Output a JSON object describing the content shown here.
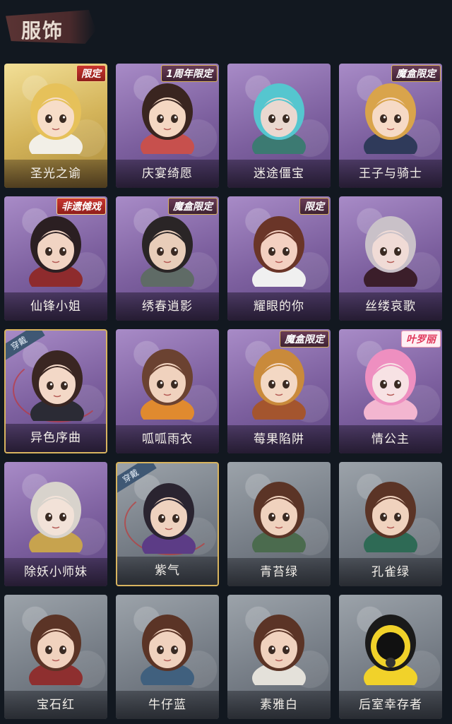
{
  "header": {
    "title": "服饰"
  },
  "worn_label": "穿戴",
  "costumes": [
    {
      "name": "圣光之谕",
      "badge": "限定",
      "badge_style": "red",
      "rarity": "gold",
      "worn": false,
      "hair": "#e6c15a",
      "skin": "#f7ddc8",
      "cloth": "#f2efe7"
    },
    {
      "name": "庆宴绮愿",
      "badge": "1周年限定",
      "badge_style": "purple",
      "rarity": "purple",
      "worn": false,
      "hair": "#3a2520",
      "skin": "#f4d7c2",
      "cloth": "#c7504d"
    },
    {
      "name": "迷途僵宝",
      "badge": "",
      "badge_style": "",
      "rarity": "purple",
      "worn": false,
      "hair": "#55c6cf",
      "skin": "#ead8d0",
      "cloth": "#3c7a72"
    },
    {
      "name": "王子与骑士",
      "badge": "魔盒限定",
      "badge_style": "purple",
      "rarity": "purple",
      "worn": false,
      "hair": "#d9a44b",
      "skin": "#f6dac6",
      "cloth": "#2f3a5a"
    },
    {
      "name": "仙锋小姐",
      "badge": "非遗傩戏",
      "badge_style": "red",
      "rarity": "purple",
      "worn": false,
      "hair": "#2b1f22",
      "skin": "#f1d4c3",
      "cloth": "#8e2b2d"
    },
    {
      "name": "绣春逍影",
      "badge": "魔盒限定",
      "badge_style": "purple",
      "rarity": "purple",
      "worn": false,
      "hair": "#2a2526",
      "skin": "#e8cdb9",
      "cloth": "#5f6b66"
    },
    {
      "name": "耀眼的你",
      "badge": "限定",
      "badge_style": "purple",
      "rarity": "purple",
      "worn": false,
      "hair": "#6a3528",
      "skin": "#f3d0c1",
      "cloth": "#f0f0f0"
    },
    {
      "name": "丝缕哀歌",
      "badge": "",
      "badge_style": "",
      "rarity": "purple",
      "worn": false,
      "hair": "#c9c1c8",
      "skin": "#f0dbd6",
      "cloth": "#3b1e2a"
    },
    {
      "name": "异色序曲",
      "badge": "",
      "badge_style": "",
      "rarity": "purple",
      "worn": true,
      "hair": "#3a2622",
      "skin": "#f3d8c7",
      "cloth": "#2b2b35"
    },
    {
      "name": "呱呱雨衣",
      "badge": "",
      "badge_style": "",
      "rarity": "purple",
      "worn": false,
      "hair": "#6b4231",
      "skin": "#f0d2be",
      "cloth": "#e08a2f"
    },
    {
      "name": "莓果陷阱",
      "badge": "魔盒限定",
      "badge_style": "purple",
      "rarity": "purple",
      "worn": false,
      "hair": "#c98a3b",
      "skin": "#f3d8c4",
      "cloth": "#a4552e"
    },
    {
      "name": "情公主",
      "badge": "叶罗丽",
      "badge_style": "pink",
      "rarity": "purple",
      "worn": false,
      "hair": "#ee8fc0",
      "skin": "#f7e2e4",
      "cloth": "#f3b6d0"
    },
    {
      "name": "除妖小师妹",
      "badge": "",
      "badge_style": "",
      "rarity": "purple",
      "worn": false,
      "hair": "#d8d3cc",
      "skin": "#f2e2d8",
      "cloth": "#c7a34e"
    },
    {
      "name": "紫气",
      "badge": "",
      "badge_style": "",
      "rarity": "gray",
      "worn": true,
      "hair": "#2a2430",
      "skin": "#efd2bf",
      "cloth": "#5c3c86"
    },
    {
      "name": "青苔绿",
      "badge": "",
      "badge_style": "",
      "rarity": "gray",
      "worn": false,
      "hair": "#5b3426",
      "skin": "#f0d2be",
      "cloth": "#4b6b4e"
    },
    {
      "name": "孔雀绿",
      "badge": "",
      "badge_style": "",
      "rarity": "gray",
      "worn": false,
      "hair": "#5b3426",
      "skin": "#f0d2be",
      "cloth": "#2e6a55"
    },
    {
      "name": "宝石红",
      "badge": "",
      "badge_style": "",
      "rarity": "gray",
      "worn": false,
      "hair": "#5b3426",
      "skin": "#f0d2be",
      "cloth": "#8e2f2f"
    },
    {
      "name": "牛仔蓝",
      "badge": "",
      "badge_style": "",
      "rarity": "gray",
      "worn": false,
      "hair": "#5b3426",
      "skin": "#f0d2be",
      "cloth": "#40607e"
    },
    {
      "name": "素雅白",
      "badge": "",
      "badge_style": "",
      "rarity": "gray",
      "worn": false,
      "hair": "#5b3426",
      "skin": "#f0d2be",
      "cloth": "#e4e1da"
    },
    {
      "name": "后室幸存者",
      "badge": "",
      "badge_style": "",
      "rarity": "gray",
      "worn": false,
      "hair": "#1a1a1a",
      "skin": "#1a1a1a",
      "cloth": "#f1d22a"
    }
  ]
}
